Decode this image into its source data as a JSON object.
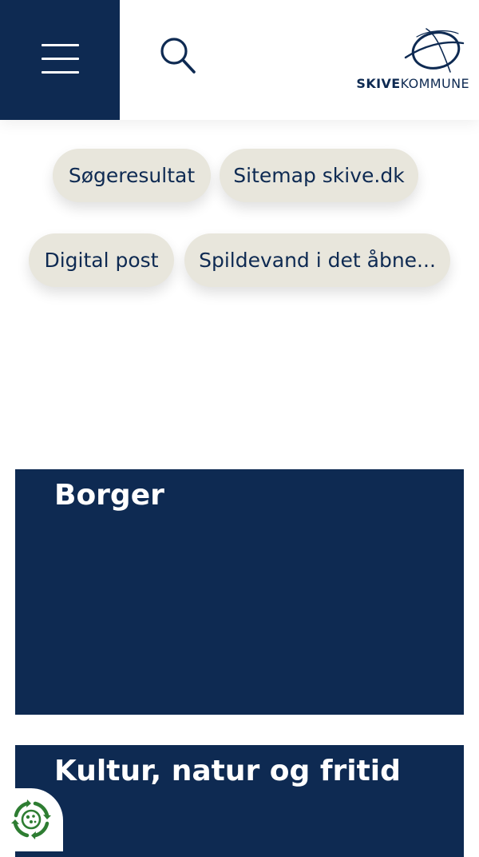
{
  "header": {
    "menu_icon": "hamburger-menu-icon",
    "search_icon": "search-icon",
    "logo": {
      "text_bold": "SKIVE",
      "text_light": "KOMMUNE"
    }
  },
  "quick_links": [
    {
      "label": "Søgeresultat"
    },
    {
      "label": "Sitemap skive.dk"
    },
    {
      "label": "Digital post"
    },
    {
      "label": "Spildevand i det åbne..."
    }
  ],
  "categories": [
    {
      "title": "Borger"
    },
    {
      "title": "Kultur, natur og fritid"
    }
  ],
  "floating_widget": {
    "icon": "recycle-widget-icon"
  },
  "colors": {
    "brand_navy": "#0e2a52",
    "pill_background": "#e8e6dc",
    "widget_green": "#2e7d32"
  }
}
